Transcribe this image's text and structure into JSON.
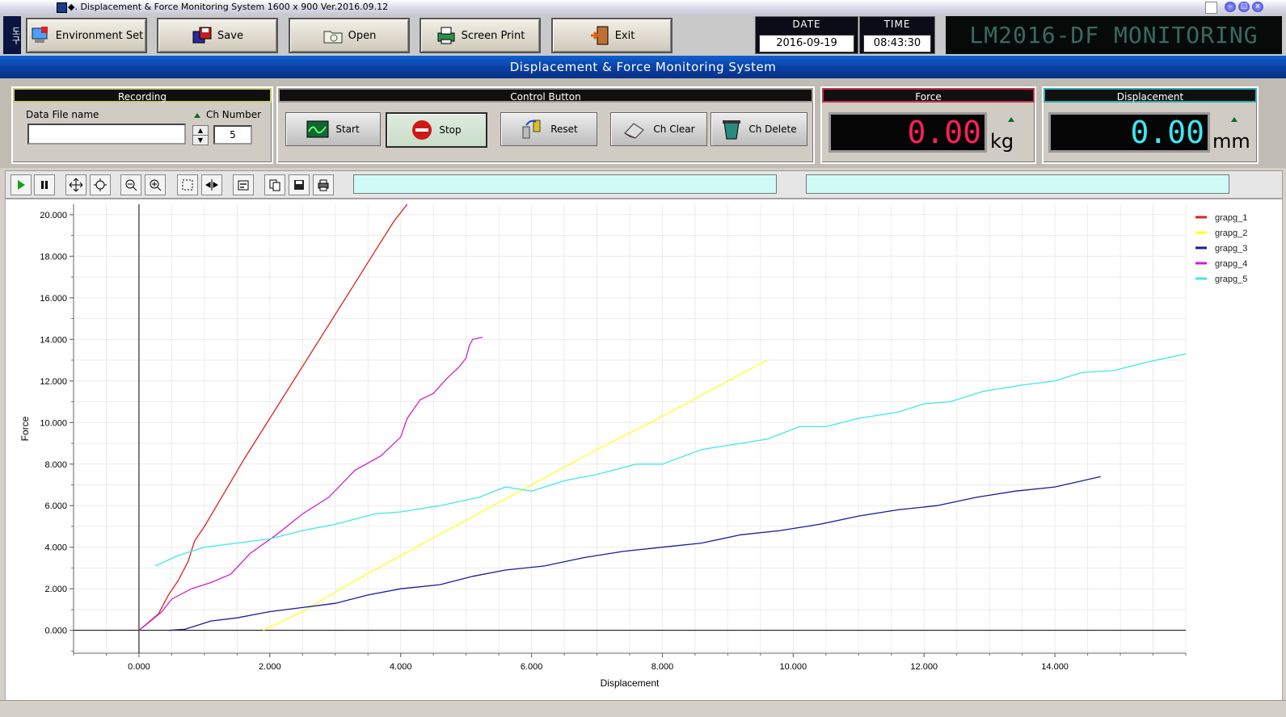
{
  "window": {
    "title": "◆. Displacement  & Force Monitoring System 1600 x 900  Ver.2016.09.12"
  },
  "header": {
    "side_label": "도구",
    "buttons": [
      {
        "label": "Environment Set",
        "icon": "settings-pc-icon"
      },
      {
        "label": "Save",
        "icon": "save-disks-icon"
      },
      {
        "label": "Open",
        "icon": "open-folder-icon"
      },
      {
        "label": "Screen Print",
        "icon": "screen-print-icon"
      },
      {
        "label": "Exit",
        "icon": "exit-door-icon"
      }
    ],
    "date_label": "DATE",
    "date_value": "2016-09-19",
    "time_label": "TIME",
    "time_value": "08:43:30",
    "brand": "LM2016-DF MONITORING"
  },
  "band": {
    "title": "Displacement  &  Force  Monitoring  System"
  },
  "recording": {
    "title": "Recording",
    "file_label": "Data File name",
    "file_value": "",
    "ch_label": "Ch Number",
    "ch_value": "5"
  },
  "control": {
    "title": "Control Button",
    "buttons": [
      {
        "label": "Start"
      },
      {
        "label": "Stop"
      },
      {
        "label": "Reset"
      },
      {
        "label": "Ch Clear"
      },
      {
        "label": "Ch Delete"
      }
    ]
  },
  "force": {
    "title": "Force",
    "value": "0.00",
    "unit": "kg",
    "color": "#ff1f5a"
  },
  "displacement": {
    "title": "Displacement",
    "value": "0.00",
    "unit": "mm",
    "color": "#3fe8f0"
  },
  "chart_data": {
    "type": "line",
    "xlabel": "Displacement",
    "ylabel": "Force",
    "xlim": [
      -1.0,
      16.0
    ],
    "ylim": [
      -1.1,
      20.5
    ],
    "x_ticks": [
      "0.000",
      "2.000",
      "4.000",
      "6.000",
      "8.000",
      "10.000",
      "12.000",
      "14.000"
    ],
    "x_tick_values": [
      0,
      2,
      4,
      6,
      8,
      10,
      12,
      14
    ],
    "y_ticks": [
      "0.000",
      "2.000",
      "4.000",
      "6.000",
      "8.000",
      "10.000",
      "12.000",
      "14.000",
      "16.000",
      "18.000",
      "20.000"
    ],
    "y_tick_values": [
      0,
      2,
      4,
      6,
      8,
      10,
      12,
      14,
      16,
      18,
      20
    ],
    "grid": true,
    "legend_position": "top-right",
    "series": [
      {
        "name": "grapg_1",
        "color": "#e0201a",
        "x": [
          0.0,
          0.3,
          0.45,
          0.6,
          0.75,
          0.85,
          1.0,
          1.3,
          1.6,
          2.0,
          2.4,
          2.8,
          3.2,
          3.6,
          3.9,
          4.1
        ],
        "y": [
          0.0,
          0.8,
          1.7,
          2.4,
          3.3,
          4.3,
          5.0,
          6.6,
          8.2,
          10.2,
          12.2,
          14.2,
          16.2,
          18.2,
          19.7,
          20.5
        ]
      },
      {
        "name": "grapg_2",
        "color": "#ffff20",
        "x": [
          1.9,
          2.5,
          3.2,
          4.0,
          5.0,
          6.0,
          7.0,
          8.0,
          9.0,
          9.6
        ],
        "y": [
          0.0,
          0.9,
          2.2,
          3.6,
          5.3,
          7.0,
          8.7,
          10.3,
          12.0,
          13.0
        ]
      },
      {
        "name": "grapg_3",
        "color": "#1a1aa0",
        "x": [
          0.45,
          0.7,
          1.1,
          1.5,
          2.0,
          2.5,
          3.0,
          3.5,
          4.0,
          4.6,
          5.1,
          5.6,
          6.2,
          6.8,
          7.4,
          8.0,
          8.6,
          9.2,
          9.8,
          10.4,
          11.0,
          11.6,
          12.2,
          12.8,
          13.4,
          14.0,
          14.7
        ],
        "y": [
          0.0,
          0.05,
          0.45,
          0.6,
          0.9,
          1.1,
          1.3,
          1.7,
          2.0,
          2.2,
          2.6,
          2.9,
          3.1,
          3.5,
          3.8,
          4.0,
          4.2,
          4.6,
          4.8,
          5.1,
          5.5,
          5.8,
          6.0,
          6.4,
          6.7,
          6.9,
          7.4
        ]
      },
      {
        "name": "grapg_4",
        "color": "#d020d0",
        "x": [
          0.0,
          0.2,
          0.35,
          0.5,
          0.8,
          1.1,
          1.4,
          1.7,
          2.1,
          2.5,
          2.9,
          3.3,
          3.7,
          4.0,
          4.1,
          4.3,
          4.5,
          4.7,
          4.9,
          5.0,
          5.05,
          5.1,
          5.25
        ],
        "y": [
          0.0,
          0.5,
          0.9,
          1.5,
          2.0,
          2.3,
          2.7,
          3.7,
          4.6,
          5.6,
          6.4,
          7.7,
          8.4,
          9.3,
          10.2,
          11.1,
          11.4,
          12.1,
          12.7,
          13.1,
          13.7,
          14.0,
          14.1
        ]
      },
      {
        "name": "grapg_5",
        "color": "#40e8e8",
        "x": [
          0.25,
          0.6,
          1.0,
          1.5,
          2.0,
          2.5,
          3.0,
          3.6,
          4.0,
          4.6,
          5.2,
          5.6,
          6.0,
          6.5,
          7.0,
          7.6,
          8.0,
          8.6,
          9.0,
          9.6,
          10.1,
          10.5,
          11.0,
          11.6,
          12.0,
          12.4,
          12.9,
          13.5,
          14.0,
          14.4,
          14.9,
          15.4,
          16.0
        ],
        "y": [
          3.1,
          3.6,
          4.0,
          4.2,
          4.4,
          4.8,
          5.1,
          5.6,
          5.7,
          6.0,
          6.4,
          6.9,
          6.7,
          7.2,
          7.5,
          8.0,
          8.0,
          8.7,
          8.9,
          9.2,
          9.8,
          9.8,
          10.2,
          10.5,
          10.9,
          11.0,
          11.5,
          11.8,
          12.0,
          12.4,
          12.5,
          12.9,
          13.3
        ]
      }
    ]
  }
}
